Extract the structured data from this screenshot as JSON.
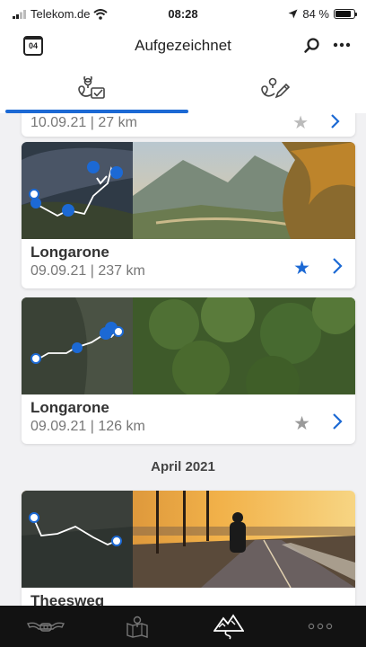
{
  "status": {
    "carrier": "Telekom.de",
    "time": "08:28",
    "battery": "84 %",
    "battery_level": 0.84
  },
  "nav": {
    "calendar_day": "04",
    "title": "Aufgezeichnet",
    "search_icon": "search-icon",
    "more_icon": "more-icon"
  },
  "tabs": [
    {
      "icon": "recorded-route-icon",
      "active": true
    },
    {
      "icon": "planned-route-icon",
      "active": false
    }
  ],
  "trips": [
    {
      "meta": "10.09.21 | 27 km"
    },
    {
      "title": "Longarone",
      "meta": "09.09.21 | 237 km",
      "favorite": true
    },
    {
      "title": "Longarone",
      "meta": "09.09.21 | 126 km",
      "favorite": false
    },
    {
      "title": "Theesweg",
      "meta": ""
    }
  ],
  "section_header": "April 2021",
  "colors": {
    "accent": "#1c69d4",
    "star_inactive": "#9a9a9a",
    "bottom_bar": "#121212"
  },
  "bottom_nav": [
    {
      "icon": "motorcycle-icon",
      "active": false
    },
    {
      "icon": "map-icon",
      "active": false
    },
    {
      "icon": "trips-mountain-icon",
      "active": true
    },
    {
      "icon": "more-dots-icon",
      "active": false
    }
  ]
}
